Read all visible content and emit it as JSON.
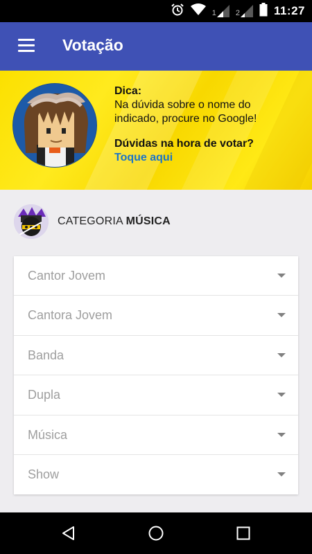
{
  "status_bar": {
    "sim1": "1",
    "sim2": "2",
    "time": "11:27",
    "icons": [
      "alarm-icon",
      "wifi-icon",
      "signal-icon",
      "signal-icon",
      "battery-icon"
    ]
  },
  "app_bar": {
    "title": "Votação",
    "menu_icon": "hamburger-menu-icon"
  },
  "tip": {
    "label": "Dica:",
    "text": "Na dúvida sobre o nome do indicado, procure no Google!",
    "question": "Dúvidas na hora de votar?",
    "link": "Toque aqui"
  },
  "category": {
    "prefix": "CATEGORIA",
    "name": "MÚSICA"
  },
  "dropdowns": [
    {
      "placeholder": "Cantor Jovem"
    },
    {
      "placeholder": "Cantora Jovem"
    },
    {
      "placeholder": "Banda"
    },
    {
      "placeholder": "Dupla"
    },
    {
      "placeholder": "Música"
    },
    {
      "placeholder": "Show"
    }
  ],
  "nav_bar": {
    "icons": [
      "back-icon",
      "home-icon",
      "recents-icon"
    ]
  },
  "colors": {
    "app_bar": "#3f51b5",
    "banner": "#fbe000",
    "link": "#1a74c9"
  }
}
